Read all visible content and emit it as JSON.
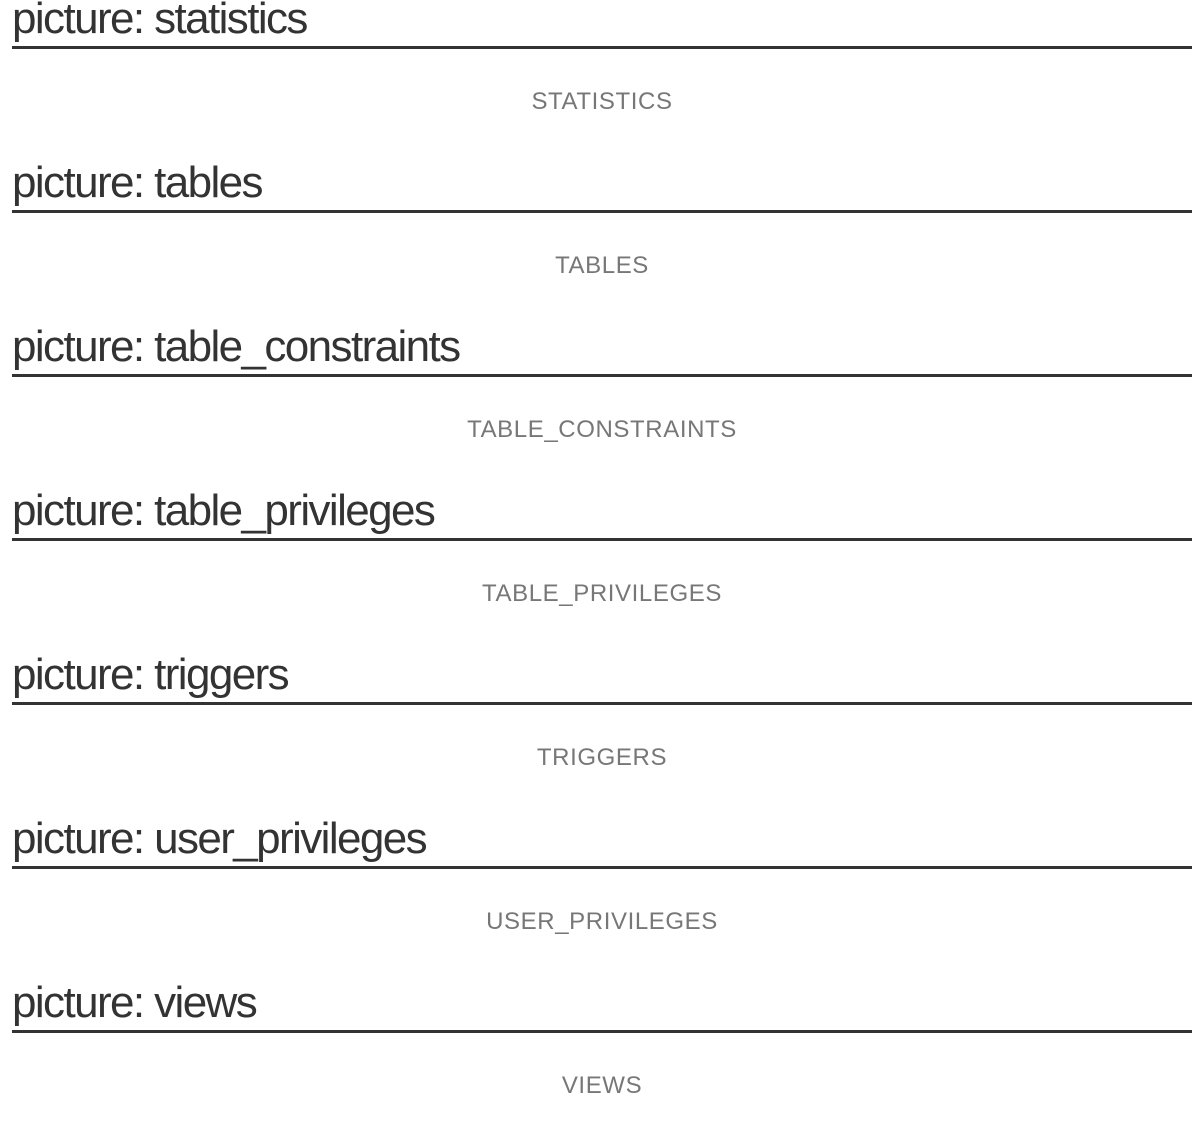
{
  "sections": [
    {
      "heading": "picture: statistics",
      "caption": "STATISTICS"
    },
    {
      "heading": "picture: tables",
      "caption": "TABLES"
    },
    {
      "heading": "picture: table_constraints",
      "caption": "TABLE_CONSTRAINTS"
    },
    {
      "heading": "picture: table_privileges",
      "caption": "TABLE_PRIVILEGES"
    },
    {
      "heading": "picture: triggers",
      "caption": "TRIGGERS"
    },
    {
      "heading": "picture: user_privileges",
      "caption": "USER_PRIVILEGES"
    },
    {
      "heading": "picture: views",
      "caption": "VIEWS"
    }
  ],
  "colors": {
    "heading_text": "#333333",
    "rule": "#333333",
    "caption_text": "#777777",
    "background": "#ffffff"
  }
}
